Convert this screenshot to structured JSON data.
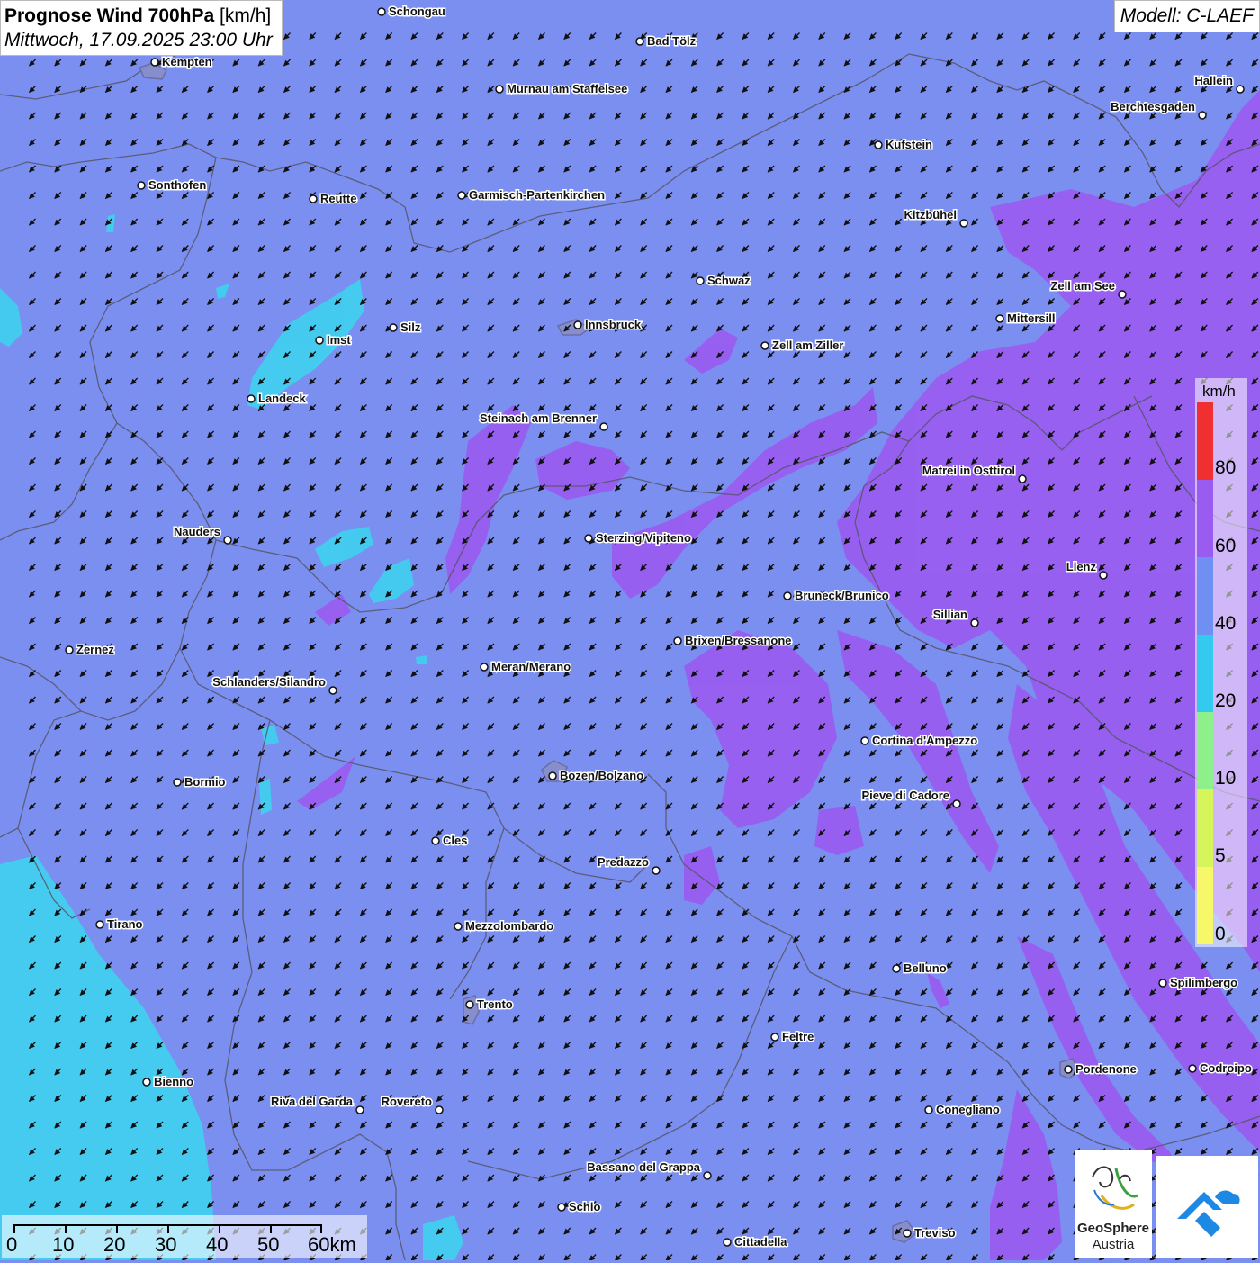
{
  "header": {
    "title_main": "Prognose Wind 700hPa",
    "title_unit": " [km/h]",
    "datetime": "Mittwoch, 17.09.2025 23:00 Uhr"
  },
  "model": {
    "label": "Modell: C-LAEF"
  },
  "legend": {
    "unit": "km/h",
    "labels": [
      "80",
      "60",
      "40",
      "20",
      "10",
      "5",
      "0"
    ],
    "colors": {
      "80": "#f03030",
      "60": "#9a5cf0",
      "40": "#6f8ff2",
      "20": "#34c9ef",
      "10": "#8ef08a",
      "5": "#d5f55a",
      "0": "#f7f76a"
    }
  },
  "colors": {
    "background": "#7b8ff0",
    "violet_area": "#9a5cf0",
    "cyan_area": "#3fd0ef",
    "border": "#555566",
    "arrow": "#111111"
  },
  "wind": {
    "direction_deg_toward": 135,
    "speed_class": "40-60"
  },
  "cities": [
    {
      "name": "Schongau"
    },
    {
      "name": "Bad Tölz"
    },
    {
      "name": "Kempten"
    },
    {
      "name": "Murnau am Staffelsee"
    },
    {
      "name": "Hallein"
    },
    {
      "name": "Berchtesgaden"
    },
    {
      "name": "Kufstein"
    },
    {
      "name": "Sonthofen"
    },
    {
      "name": "Reutte"
    },
    {
      "name": "Garmisch-Partenkirchen"
    },
    {
      "name": "Kitzbühel"
    },
    {
      "name": "Schwaz"
    },
    {
      "name": "Zell am See"
    },
    {
      "name": "Mittersill"
    },
    {
      "name": "Silz"
    },
    {
      "name": "Imst"
    },
    {
      "name": "Innsbruck"
    },
    {
      "name": "Zell am Ziller"
    },
    {
      "name": "Landeck"
    },
    {
      "name": "Steinach am Brenner"
    },
    {
      "name": "Matrei in Osttirol"
    },
    {
      "name": "Nauders"
    },
    {
      "name": "Sterzing/Vipiteno"
    },
    {
      "name": "Lienz"
    },
    {
      "name": "Bruneck/Brunico"
    },
    {
      "name": "Sillian"
    },
    {
      "name": "Zernez"
    },
    {
      "name": "Brixen/Bressanone"
    },
    {
      "name": "Meran/Merano"
    },
    {
      "name": "Schlanders/Silandro"
    },
    {
      "name": "Cortina d'Ampezzo"
    },
    {
      "name": "Bormio"
    },
    {
      "name": "Bozen/Bolzano"
    },
    {
      "name": "Pieve di Cadore"
    },
    {
      "name": "Cles"
    },
    {
      "name": "Predazzo"
    },
    {
      "name": "Tirano"
    },
    {
      "name": "Mezzolombardo"
    },
    {
      "name": "Belluno"
    },
    {
      "name": "Spilimbergo"
    },
    {
      "name": "Trento"
    },
    {
      "name": "Feltre"
    },
    {
      "name": "Pordenone"
    },
    {
      "name": "Codroipo"
    },
    {
      "name": "Bienno"
    },
    {
      "name": "Riva del Garda"
    },
    {
      "name": "Rovereto"
    },
    {
      "name": "Conegliano"
    },
    {
      "name": "Bassano del Grappa"
    },
    {
      "name": "Schio"
    },
    {
      "name": "Treviso"
    },
    {
      "name": "Cittadella"
    }
  ],
  "scalebar": {
    "labels": [
      "0",
      "10",
      "20",
      "30",
      "40",
      "50",
      "60km"
    ]
  },
  "logos": {
    "geosphere_line1": "GeoSphere",
    "geosphere_line2": "Austria"
  }
}
